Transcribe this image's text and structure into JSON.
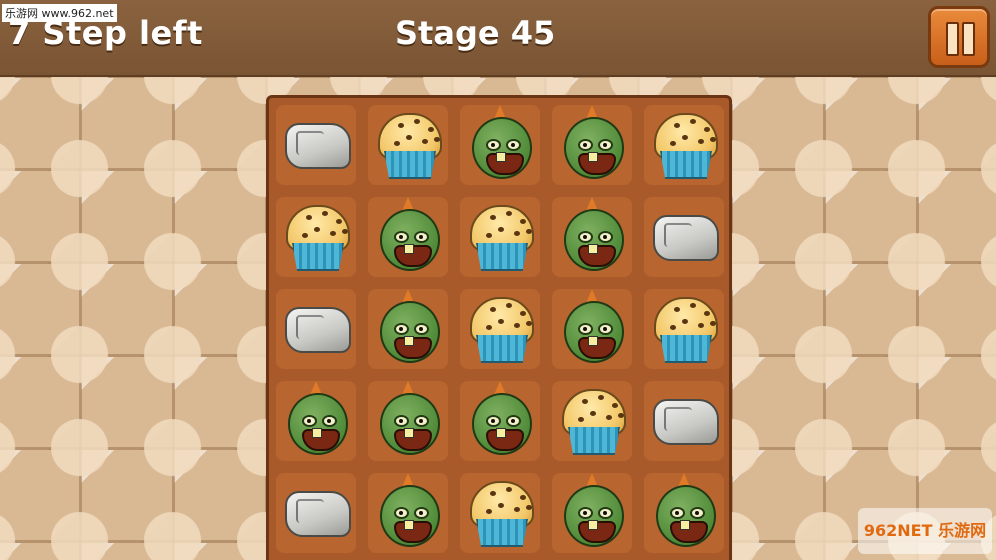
{
  "hud": {
    "steps_text": "7 Step left",
    "stage_text": "Stage 45",
    "pause_icon": "pause-icon"
  },
  "watermark": {
    "top_left": "乐游网 www.962.net",
    "bottom_right": "962NET 乐游网"
  },
  "board": {
    "rows": 5,
    "cols": 5,
    "cells": [
      [
        "rock",
        "muffin",
        "zombie",
        "zombie",
        "muffin"
      ],
      [
        "muffin",
        "zombie",
        "muffin",
        "zombie",
        "rock"
      ],
      [
        "rock",
        "zombie",
        "muffin",
        "zombie",
        "muffin"
      ],
      [
        "zombie",
        "zombie",
        "zombie",
        "muffin",
        "rock"
      ],
      [
        "rock",
        "zombie",
        "muffin",
        "zombie",
        "zombie"
      ]
    ]
  },
  "colors": {
    "hud_bg": "#7a5533",
    "board_bg": "#a85a2a",
    "pause_button": "#e07a28"
  }
}
